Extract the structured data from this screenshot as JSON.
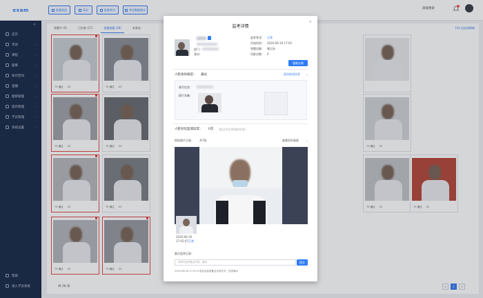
{
  "sidebar": {
    "brand": "exam",
    "items": [
      {
        "label": "首页",
        "icon": "home-icon"
      },
      {
        "label": "考试",
        "icon": "exam-icon"
      },
      {
        "label": "课程",
        "icon": "course-icon"
      },
      {
        "label": "题库",
        "icon": "question-bank-icon"
      },
      {
        "label": "知识空间",
        "icon": "knowledge-icon"
      },
      {
        "label": "直播",
        "icon": "live-icon"
      },
      {
        "label": "题目管理",
        "icon": "question-manage-icon"
      },
      {
        "label": "操作管理",
        "icon": "operation-icon"
      },
      {
        "label": "学员管理",
        "icon": "student-icon"
      },
      {
        "label": "系统设置",
        "icon": "settings-icon"
      }
    ],
    "bottom": [
      {
        "label": "帮助",
        "icon": "help-icon"
      },
      {
        "label": "进入学员系统",
        "icon": "enter-icon"
      }
    ]
  },
  "topbar": {
    "buttons": [
      "批量发送",
      "导出",
      "批量考试",
      "考试数据",
      "考试数据统计"
    ],
    "right_label": "高级搜索"
  },
  "content": {
    "tabs": [
      "答题中 (0)",
      "已交卷 (27)",
      "批量查看 (28)",
      "未参加"
    ],
    "right_info": "10s 后自动刷新",
    "total": "共 28 条",
    "pager": [
      "<",
      "1",
      ">"
    ]
  },
  "cards": [
    {
      "status": "79 通过",
      "count": "43",
      "alert": true
    },
    {
      "status": "79 通过",
      "count": "43",
      "alert": false
    },
    {
      "status": "",
      "count": "",
      "alert": false
    },
    {
      "status": "79 通过",
      "count": "53",
      "alert": true
    },
    {
      "status": "79 通过",
      "count": "43",
      "alert": false
    },
    {
      "status": "79 通过",
      "count": "53",
      "alert": false
    },
    {
      "status": "79 通过",
      "count": "43",
      "alert": true
    },
    {
      "status": "79 通过",
      "count": "53",
      "alert": false
    },
    {
      "status": "79 通过",
      "count": "43",
      "alert": false
    },
    {
      "status": "79 通过",
      "count": "43",
      "alert": true
    },
    {
      "status": "79 通过",
      "count": "43",
      "alert": true
    },
    {
      "status": "79 通过",
      "count": "43",
      "alert": false
    }
  ],
  "modal": {
    "title": "监考详情",
    "close": "×",
    "info": {
      "dept_label": "部门：",
      "id_label": "身份：",
      "exam_status_label": "监考考试：",
      "exam_status_value": "正常",
      "start_label": "开始时间：",
      "start_value": "2020-06-16 17:02",
      "device_label": "答题设备：",
      "device_value": "笔记本",
      "switch_label": "切屏次数：",
      "switch_value": "0",
      "force_button": "强制交卷"
    },
    "face_verify": {
      "label": "人脸身份核验：",
      "value": "通过",
      "link": "身份核验信息",
      "photo_label_1": "填写信息：",
      "photo_label_2": "照片采集："
    },
    "monitor": {
      "label": "人脸对比监测异常：",
      "value": "0次",
      "hint": "(超过次后将强制交卷)"
    },
    "capture": {
      "label": "抓拍照片记录：",
      "value": "共7张",
      "link": "查看实时画面",
      "date": "2020-06-16",
      "time": "17:02:07",
      "tag": "正常"
    },
    "remark": {
      "label": "备注监考记录：",
      "placeholder": "请填写监考备注内容，最多...",
      "button": "提交",
      "log": "2020-06-16 17:02:4   姓名对监考备注示例文字，仅供演示"
    }
  }
}
